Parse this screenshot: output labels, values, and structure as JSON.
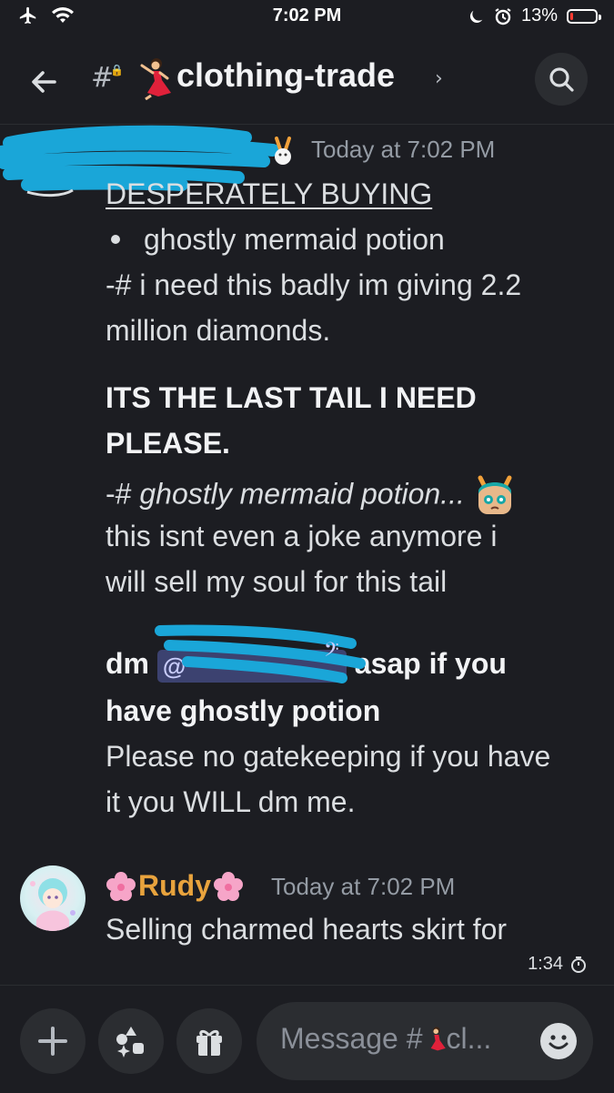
{
  "status_bar": {
    "time": "7:02 PM",
    "battery": "13%",
    "battery_level": 0.13
  },
  "header": {
    "channel_name": "clothing-trade",
    "chevron": "›"
  },
  "message1": {
    "timestamp": "Today at 7:02 PM",
    "lines": {
      "l1": "DESPERATELY BUYING",
      "l2": "ghostly mermaid potion",
      "l3": "-# i need this badly im giving 2.2",
      "l4": "million diamonds.",
      "l5": "ITS THE LAST TAIL I NEED",
      "l6": "PLEASE.",
      "l7a": "-# ",
      "l7b": "ghostly mermaid potion...",
      "l8": "this isnt even a joke anymore i",
      "l9": "will sell my soul for this tail",
      "l10a": "dm",
      "l10b": "asap if you",
      "l11": "have ghostly potion",
      "l12": "Please no gatekeeping if you have",
      "l13": "it you WILL dm me."
    },
    "mention_prefix": "@"
  },
  "message2": {
    "username": "Rudy",
    "timestamp": "Today at 7:02 PM",
    "text": "Selling charmed hearts skirt for"
  },
  "video_overlay": {
    "time": "1:34"
  },
  "composer": {
    "placeholder_prefix": "Message #",
    "placeholder_suffix": "cl..."
  },
  "icons": [
    "back-arrow-icon",
    "search-icon",
    "plus-icon",
    "apps-icon",
    "gift-icon",
    "emoji-icon",
    "timer-icon"
  ]
}
